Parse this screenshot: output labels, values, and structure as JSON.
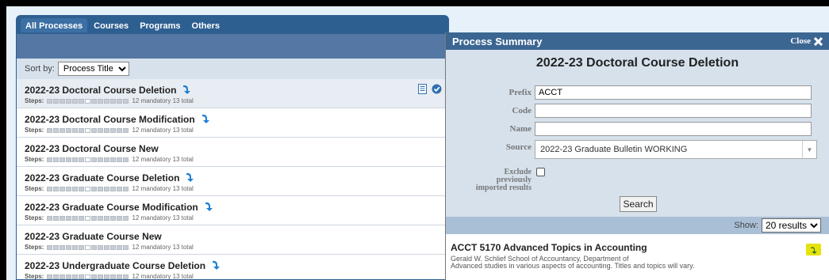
{
  "tabs": [
    {
      "label": "All Processes",
      "active": true
    },
    {
      "label": "Courses",
      "active": false
    },
    {
      "label": "Programs",
      "active": false
    },
    {
      "label": "Others",
      "active": false
    }
  ],
  "sort": {
    "label": "Sort by:",
    "selected": "Process Title"
  },
  "processes": [
    {
      "title": "2022-23 Doctoral Course Deletion",
      "steps_label": "Steps:",
      "steps_text": "12 mandatory 13 total",
      "has_arrow": true,
      "selected": true
    },
    {
      "title": "2022-23 Doctoral Course Modification",
      "steps_label": "Steps:",
      "steps_text": "12 mandatory 13 total",
      "has_arrow": true
    },
    {
      "title": "2022-23 Doctoral Course New",
      "steps_label": "Steps:",
      "steps_text": "12 mandatory 13 total",
      "has_arrow": false
    },
    {
      "title": "2022-23 Graduate Course Deletion",
      "steps_label": "Steps:",
      "steps_text": "12 mandatory 13 total",
      "has_arrow": true
    },
    {
      "title": "2022-23 Graduate Course Modification",
      "steps_label": "Steps:",
      "steps_text": "12 mandatory 13 total",
      "has_arrow": true
    },
    {
      "title": "2022-23 Graduate Course New",
      "steps_label": "Steps:",
      "steps_text": "12 mandatory 13 total",
      "has_arrow": false
    },
    {
      "title": "2022-23 Undergraduate Course Deletion",
      "steps_label": "Steps:",
      "steps_text": "12 mandatory 13 total",
      "has_arrow": true
    }
  ],
  "summary": {
    "header": "Process Summary",
    "close_label": "Close",
    "title": "2022-23 Doctoral Course Deletion",
    "prefix_label": "Prefix",
    "prefix_value": "ACCT",
    "code_label": "Code",
    "code_value": "",
    "name_label": "Name",
    "name_value": "",
    "source_label": "Source",
    "source_value": "2022-23 Graduate Bulletin WORKING",
    "exclude_label_1": "Exclude",
    "exclude_label_2": "previously",
    "exclude_label_3": "imported results",
    "search_label": "Search",
    "show_label": "Show:",
    "show_value": "20 results"
  },
  "result": {
    "title": "ACCT 5170 Advanced Topics in Accounting",
    "dept": "Gerald W. Schlief School of Accountancy, Department of",
    "desc": "Advanced studies in various aspects of accounting. Titles and topics will vary."
  },
  "colors": {
    "accent": "#2e5f91",
    "arrow": "#1e7fd1",
    "add_button": "#e8e20c"
  }
}
